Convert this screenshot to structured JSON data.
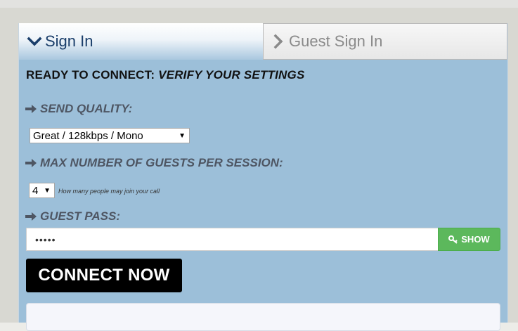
{
  "tabs": {
    "sign_in": {
      "label": "Sign In",
      "icon": "chevron-down-icon",
      "active": true
    },
    "guest_sign_in": {
      "label": "Guest Sign In",
      "icon": "chevron-right-icon",
      "active": false
    }
  },
  "heading": {
    "prefix": "READY TO CONNECT:",
    "emphasis": "VERIFY YOUR SETTINGS"
  },
  "send_quality": {
    "label": "SEND QUALITY:",
    "selected": "Great / 128kbps / Mono"
  },
  "max_guests": {
    "label": "MAX NUMBER OF GUESTS PER SESSION:",
    "selected": "4",
    "hint": "How many people may join your call"
  },
  "guest_pass": {
    "label": "GUEST PASS:",
    "value": "•••••",
    "show_label": "SHOW"
  },
  "connect": {
    "label": "CONNECT NOW"
  },
  "colors": {
    "panel_bg": "#9cbfd9",
    "active_tab_text": "#1a3e6a",
    "show_button": "#5cb85c",
    "connect_button": "#000000"
  }
}
